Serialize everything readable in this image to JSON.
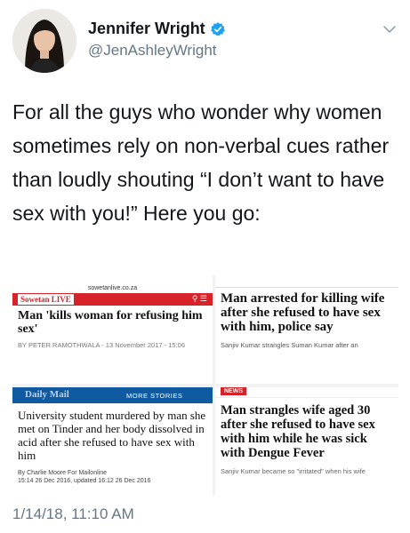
{
  "tweet": {
    "author_name": "Jennifer Wright",
    "author_handle": "@JenAshleyWright",
    "text": "For all the guys who wonder why women sometimes rely on non-verbal cues rather than loudly shouting “I don’t want to have sex with you!” Here you go:",
    "timestamp": "1/14/18, 11:10 AM"
  },
  "cards": [
    {
      "url": "sowetanlive.co.za",
      "logo": "Sowetan LIVE",
      "headline": "Man 'kills woman for refusing him sex'",
      "byline": "BY PETER RAMOTHWALA - 13 November 2017 - 15:06"
    },
    {
      "headline": "Man arrested for killing wife after she refused to have sex with him, police say",
      "byline": "Sanjiv Kumar strangles Suman Kumar after an"
    },
    {
      "logo": "Daily Mail",
      "section": "MORE STORIES",
      "headline": "University student murdered by man she met on Tinder and her body dissolved in acid after she refused to have sex with him",
      "byline": "By Charlie Moore For Mailonline",
      "dateline": "15:14 26 Dec 2016, updated 16:12 26 Dec 2016"
    },
    {
      "tag": "NEWS",
      "headline": "Man strangles wife aged 30 after she refused to have sex with him while he was sick with Dengue Fever",
      "byline": "Sanjiv Kumar became so \"irritated\" when his wife"
    }
  ],
  "icons": {
    "verified": "verified-badge-icon",
    "menu": "chevron-down-icon"
  },
  "colors": {
    "verified_blue": "#1da1f2",
    "secondary_text": "#657786",
    "sowetan_red": "#d6232a",
    "dailymail_blue": "#0f5aa0"
  }
}
